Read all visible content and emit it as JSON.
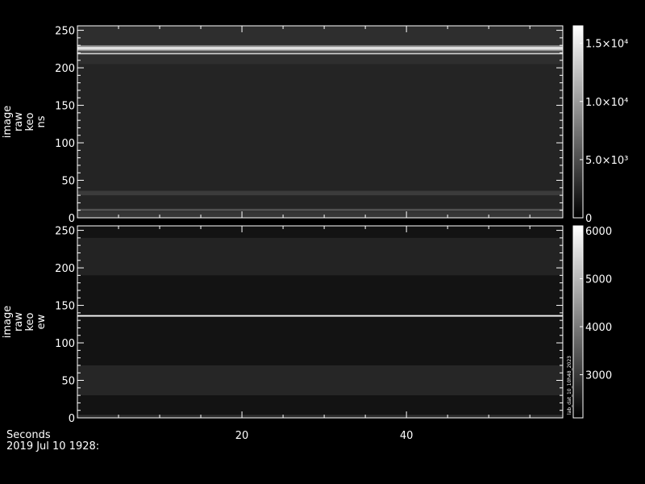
{
  "chart_data": [
    {
      "type": "heatmap",
      "ylabel_lines": [
        "image",
        "raw",
        "keo",
        "ns"
      ],
      "xlim": [
        0,
        59
      ],
      "ylim": [
        0,
        256
      ],
      "yticks": [
        0,
        50,
        100,
        150,
        200,
        250
      ],
      "ytick_labels": [
        "0",
        "50",
        "100",
        "150",
        "200",
        "250"
      ],
      "xticks": [
        20,
        40
      ],
      "colorbar": {
        "range": [
          0,
          16500
        ],
        "ticks": [
          0,
          5000,
          10000,
          15000
        ],
        "tick_labels": [
          "0",
          "5.0×10³",
          "1.0×10⁴",
          "1.5×10⁴"
        ]
      },
      "bands": [
        {
          "y_start": 0,
          "y_end": 256,
          "intensity": 2300
        },
        {
          "y_start": 30,
          "y_end": 36,
          "intensity": 3800
        },
        {
          "y_start": 9,
          "y_end": 12,
          "intensity": 5200
        },
        {
          "y_start": 0,
          "y_end": 8,
          "intensity": 3500
        },
        {
          "y_start": 205,
          "y_end": 256,
          "intensity": 3000
        },
        {
          "y_start": 222,
          "y_end": 224,
          "intensity": 9000
        },
        {
          "y_start": 224,
          "y_end": 228,
          "intensity": 14500
        },
        {
          "y_start": 228,
          "y_end": 230,
          "intensity": 9000
        },
        {
          "y_start": 218,
          "y_end": 220,
          "intensity": 13000
        }
      ]
    },
    {
      "type": "heatmap",
      "ylabel_lines": [
        "image",
        "raw",
        "keo",
        "ew"
      ],
      "xlim": [
        0,
        59
      ],
      "ylim": [
        0,
        256
      ],
      "yticks": [
        0,
        50,
        100,
        150,
        200,
        250
      ],
      "ytick_labels": [
        "0",
        "50",
        "100",
        "150",
        "200",
        "250"
      ],
      "xticks": [
        20,
        40
      ],
      "xtick_labels": [
        "20",
        "40"
      ],
      "colorbar": {
        "range": [
          2100,
          6100
        ],
        "ticks": [
          3000,
          4000,
          5000,
          6000
        ],
        "tick_labels": [
          "3000",
          "4000",
          "5000",
          "6000"
        ],
        "side_label": "lab_dat_10_10h48_2023"
      },
      "bands": [
        {
          "y_start": 0,
          "y_end": 256,
          "intensity": 2400
        },
        {
          "y_start": 0,
          "y_end": 4,
          "intensity": 2800
        },
        {
          "y_start": 30,
          "y_end": 70,
          "intensity": 2700
        },
        {
          "y_start": 190,
          "y_end": 240,
          "intensity": 2650
        },
        {
          "y_start": 135,
          "y_end": 137,
          "intensity": 6000
        }
      ]
    }
  ],
  "footer": {
    "x_caption": "Seconds",
    "date": "2019 Jul 10 1928:"
  }
}
